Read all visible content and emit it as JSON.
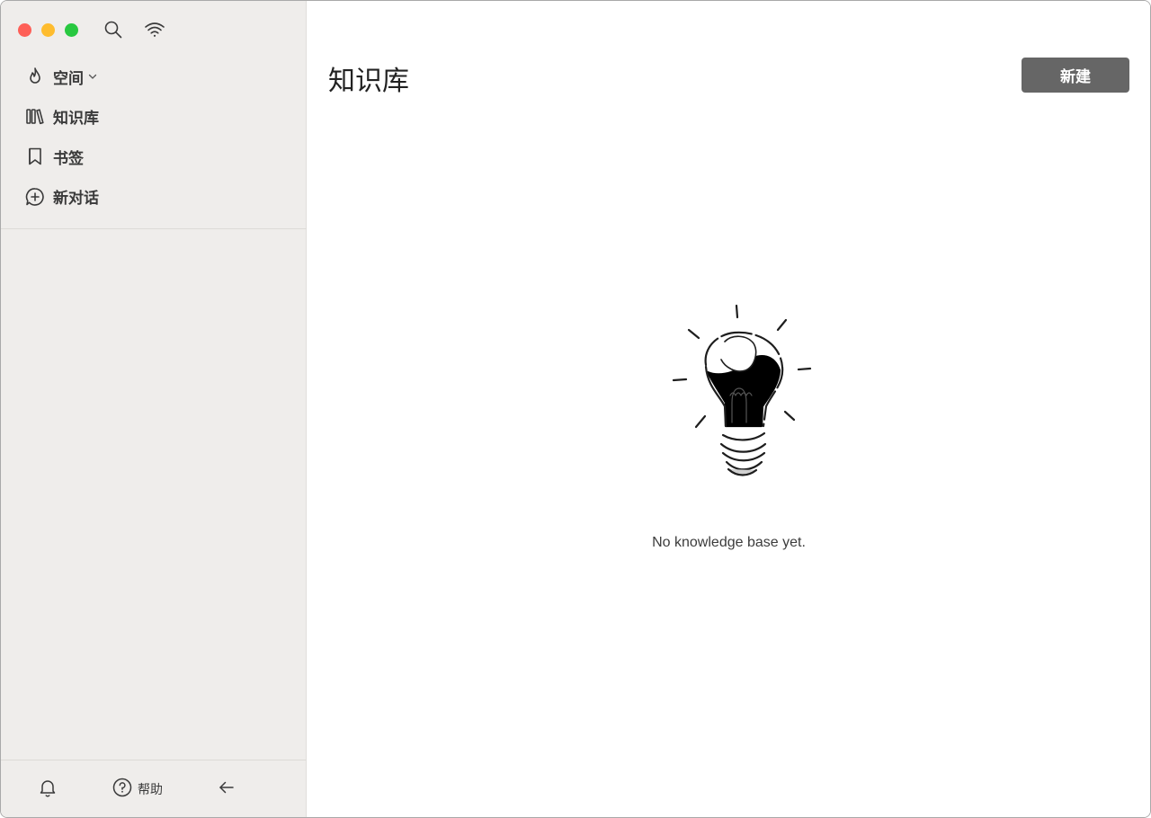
{
  "sidebar": {
    "items": [
      {
        "label": "空间",
        "icon": "flame-icon",
        "has_dropdown": true
      },
      {
        "label": "知识库",
        "icon": "library-icon"
      },
      {
        "label": "书签",
        "icon": "bookmark-icon"
      },
      {
        "label": "新对话",
        "icon": "chat-plus-icon"
      }
    ],
    "bottom": {
      "help_label": "帮助"
    }
  },
  "main": {
    "title": "知识库",
    "new_button_label": "新建",
    "empty_message": "No knowledge base yet."
  },
  "colors": {
    "sidebar_bg": "#efedeb",
    "button_bg": "#666666",
    "traffic_red": "#fe5f57",
    "traffic_yellow": "#febc2e",
    "traffic_green": "#28c840"
  }
}
